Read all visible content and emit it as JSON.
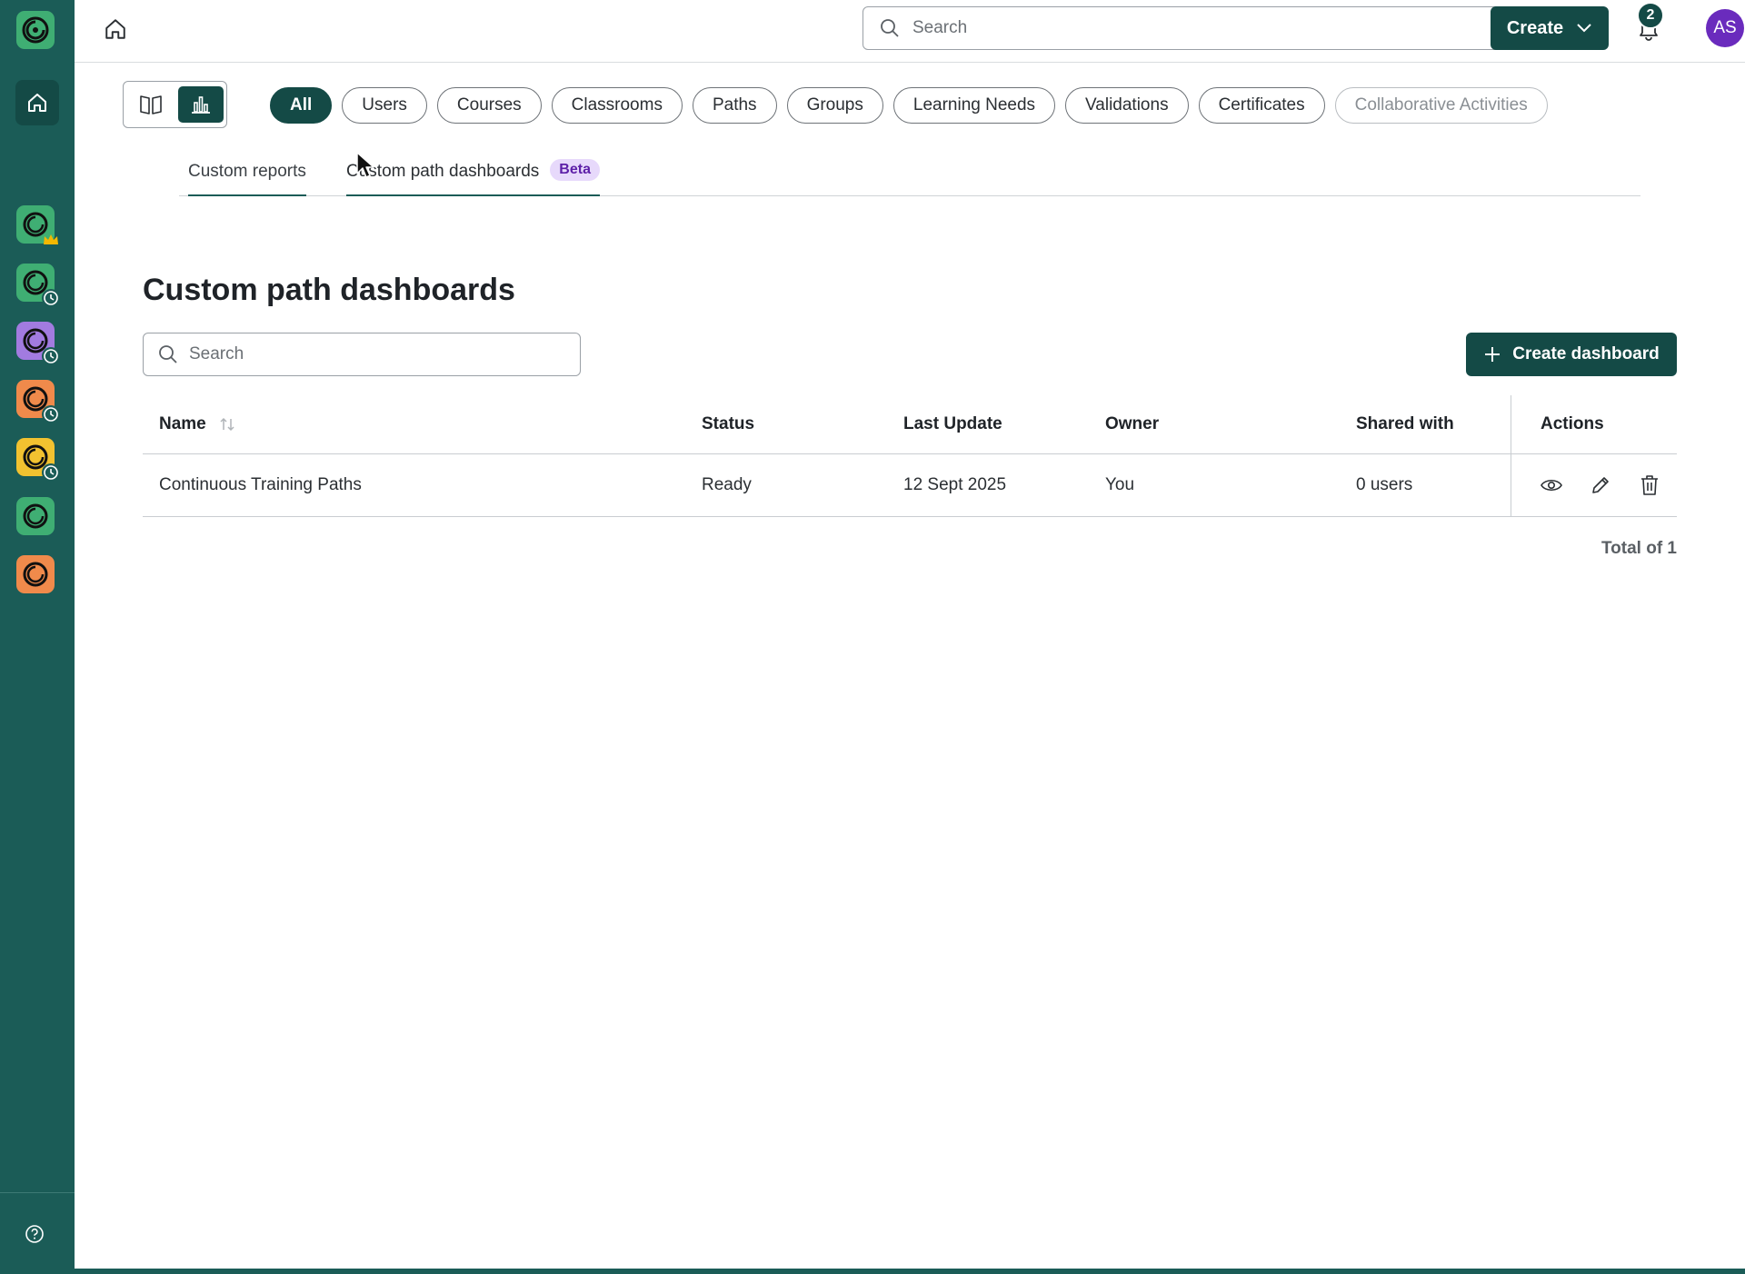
{
  "topbar": {
    "search_placeholder": "Search",
    "create_label": "Create",
    "notification_count": "2",
    "avatar_initials": "AS"
  },
  "filters": {
    "chips": [
      "All",
      "Users",
      "Courses",
      "Classrooms",
      "Paths",
      "Groups",
      "Learning Needs",
      "Validations",
      "Certificates",
      "Collaborative Activities"
    ],
    "active": "All"
  },
  "subtabs": {
    "custom_reports": "Custom reports",
    "custom_path_dashboards": "Custom path dashboards",
    "beta": "Beta"
  },
  "page": {
    "title": "Custom path dashboards",
    "search_placeholder": "Search",
    "create_dashboard_label": "Create dashboard"
  },
  "table": {
    "headers": {
      "name": "Name",
      "status": "Status",
      "last_update": "Last Update",
      "owner": "Owner",
      "shared_with": "Shared with",
      "actions": "Actions"
    },
    "rows": [
      {
        "name": "Continuous Training Paths",
        "status": "Ready",
        "last_update": "12 Sept 2025",
        "owner": "You",
        "shared_with": "0 users"
      }
    ],
    "total": "Total of 1"
  },
  "colors": {
    "rail": "#1b5c57",
    "primary": "#144a46",
    "beta_bg": "#e7d9fb",
    "beta_text": "#5d1fa8",
    "avatar": "#6a2bbd"
  },
  "rail_apps": [
    {
      "icon": "app-logo-icon",
      "color": "#3fae73",
      "badge": "crown-icon"
    },
    {
      "icon": "app-logo-icon",
      "color": "#3fae73",
      "badge": "clock-icon"
    },
    {
      "icon": "app-logo-icon",
      "color": "#a27be0",
      "badge": "clock-icon"
    },
    {
      "icon": "app-logo-icon",
      "color": "#f08a4b",
      "badge": "clock-icon"
    },
    {
      "icon": "app-logo-icon",
      "color": "#f2c230",
      "badge": "clock-icon"
    },
    {
      "icon": "app-logo-icon",
      "color": "#3fae73",
      "badge": ""
    },
    {
      "icon": "app-logo-icon",
      "color": "#f08a4b",
      "badge": ""
    }
  ]
}
